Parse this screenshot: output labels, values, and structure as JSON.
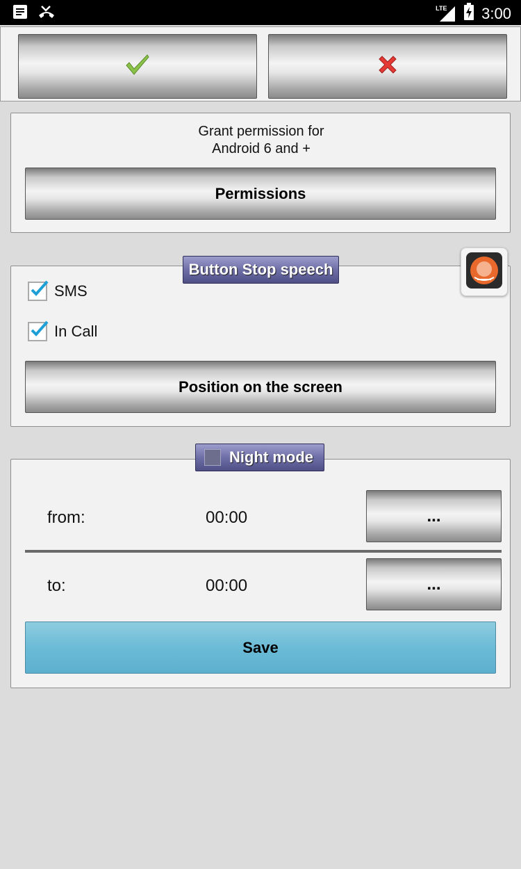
{
  "status_bar": {
    "time": "3:00",
    "network": "LTE",
    "icons": [
      "notification-icon",
      "missed-call-icon",
      "signal-icon",
      "battery-charging-icon"
    ]
  },
  "top_actions": {
    "confirm_icon": "checkmark-icon",
    "cancel_icon": "x-icon"
  },
  "permissions_panel": {
    "text_line1": "Grant permission for",
    "text_line2": "Android 6 and +",
    "button_label": "Permissions"
  },
  "stop_speech_panel": {
    "legend": "Button Stop speech",
    "sms_label": "SMS",
    "sms_checked": true,
    "call_label": "In Call",
    "call_checked": true,
    "position_button_label": "Position on the screen"
  },
  "night_mode_panel": {
    "legend": "Night mode",
    "enabled": false,
    "from_label": "from:",
    "from_value": "00:00",
    "to_label": "to:",
    "to_value": "00:00",
    "pick_button_label": "...",
    "save_label": "Save"
  },
  "colors": {
    "legend_tab": "#6f6fa8",
    "save_button": "#6bbbd6",
    "checkbox_accent": "#1e9fd6",
    "confirm_icon": "#8bc34a",
    "cancel_icon": "#e53935"
  }
}
